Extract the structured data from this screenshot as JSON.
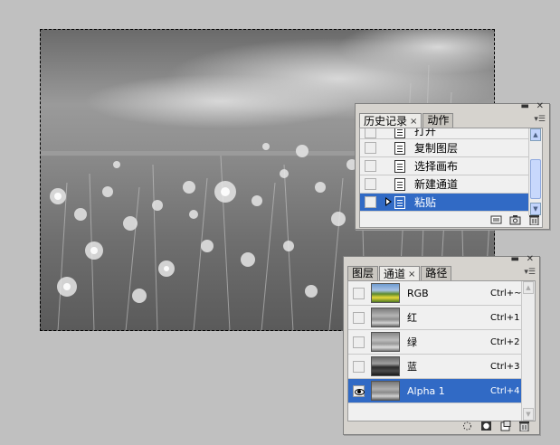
{
  "history_panel": {
    "tabs": [
      {
        "label": "历史记录",
        "active": true,
        "close": "×"
      },
      {
        "label": "动作",
        "active": false
      }
    ],
    "items": [
      {
        "label": "打开",
        "selected": false
      },
      {
        "label": "复制图层",
        "selected": false
      },
      {
        "label": "选择画布",
        "selected": false
      },
      {
        "label": "新建通道",
        "selected": false
      },
      {
        "label": "粘贴",
        "selected": true
      }
    ],
    "footer_icons": [
      "new-document-from-state-icon",
      "snapshot-camera-icon",
      "trash-icon"
    ]
  },
  "channels_panel": {
    "tabs": [
      {
        "label": "图层",
        "active": false
      },
      {
        "label": "通道",
        "active": true,
        "close": "×"
      },
      {
        "label": "路径",
        "active": false
      }
    ],
    "channels": [
      {
        "name": "RGB",
        "shortcut": "Ctrl+~",
        "visible": false,
        "selected": false,
        "thumb": "color"
      },
      {
        "name": "红",
        "shortcut": "Ctrl+1",
        "visible": false,
        "selected": false,
        "thumb": "gray"
      },
      {
        "name": "绿",
        "shortcut": "Ctrl+2",
        "visible": false,
        "selected": false,
        "thumb": "gray"
      },
      {
        "name": "蓝",
        "shortcut": "Ctrl+3",
        "visible": false,
        "selected": false,
        "thumb": "dark"
      },
      {
        "name": "Alpha 1",
        "shortcut": "Ctrl+4",
        "visible": true,
        "selected": true,
        "thumb": "gray"
      }
    ],
    "footer_icons": [
      "load-selection-icon",
      "save-selection-icon",
      "new-channel-icon",
      "trash-icon"
    ]
  },
  "colors": {
    "selection": "#316ac5",
    "workspace": "#c0c0c0",
    "panel": "#d6d3ce"
  }
}
